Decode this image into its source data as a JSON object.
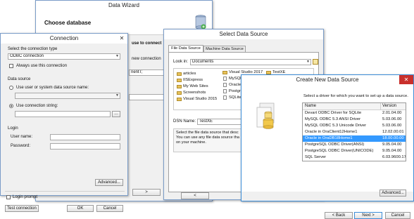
{
  "wizard": {
    "title": "Data Wizard",
    "heading": "Choose database",
    "side_text_1": "use to connect",
    "side_text_2": "new connection",
    "side_text_3": "nentT;",
    "next_label": ">"
  },
  "connection": {
    "title": "Connection",
    "section_type": "Select the connection type",
    "type_value": "ODBC connection",
    "always_use": "Always use this connection",
    "section_source": "Data source",
    "radio_dsn": "Use user or system data source name:",
    "radio_conn": "Use connection string:",
    "section_login": "Login",
    "user_label": "User name:",
    "password_label": "Password:",
    "advanced": "Advanced...",
    "login_prompt": "Login prompt",
    "test_connection": "Test connection",
    "ok": "OK",
    "cancel": "Cancel"
  },
  "select_source": {
    "title": "Select Data Source",
    "tab_file": "File Data Source",
    "tab_machine": "Machine Data Source",
    "look_in_label": "Look in:",
    "look_in_value": "Documents",
    "items_col1": [
      "articles",
      "IISExpress",
      "My Web Sites",
      "Screenshots",
      "Visual Studio 2015"
    ],
    "items_col2": [
      "Visual Studio 2017",
      "MySQL",
      "Oracle",
      "PostgreSQL",
      "SQLite"
    ],
    "items_col3": [
      "TestXE"
    ],
    "dsn_label": "DSN Name:",
    "dsn_value": "TestXE",
    "desc": "Select the file data source that describes the driver that you wish to connect to. You can use any file data source that refers to an ODBC driver which is installed on your machine.",
    "desc_lines": [
      "Select the file data source that desc",
      "You can use any file data source tha",
      "on your machine."
    ],
    "back": "<"
  },
  "create_source": {
    "title": "Create New Data Source",
    "instruction": "Select a driver for which you want to set up a data source.",
    "col_name": "Name",
    "col_version": "Version",
    "drivers": [
      {
        "name": "Devart ODBC Driver for SQLite",
        "version": "2.01.04.00"
      },
      {
        "name": "MySQL ODBC 5.3 ANSI Driver",
        "version": "5.03.06.00"
      },
      {
        "name": "MySQL ODBC 5.3 Unicode Driver",
        "version": "5.03.06.00"
      },
      {
        "name": "Oracle in OraClient12Home1",
        "version": "12.02.00.01"
      },
      {
        "name": "Oracle in OraDB18Home1",
        "version": "18.00.00.00"
      },
      {
        "name": "PostgreSQL ODBC Driver(ANSI)",
        "version": "9.05.04.00"
      },
      {
        "name": "PostgreSQL ODBC Driver(UNICODE)",
        "version": "9.05.04.00"
      },
      {
        "name": "SQL Server",
        "version": "6.03.9600.174"
      }
    ],
    "selected_index": 4,
    "advanced": "Advanced...",
    "back": "< Back",
    "next": "Next >",
    "cancel": "Cancel"
  },
  "colors": {
    "selection": "#3399ff",
    "close_red": "#c9302c",
    "accent_border": "#7a9cc8"
  }
}
